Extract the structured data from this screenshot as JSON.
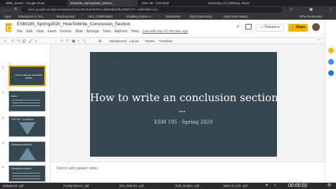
{
  "browser": {
    "tabs": [
      {
        "label": "Slide_Series - Google Drive"
      },
      {
        "label": "ESM195_Spring2020_HowTo..."
      },
      {
        "label": "ENV 38 - Fall 2019"
      },
      {
        "label": "University of California, Davis"
      }
    ],
    "url": "docs.google.com/presentation/d/1QvmRL9r4h0H8YLzd6N6BG6f5v3Z8EYbT...edit#slide=id.p",
    "bookmarks": [
      "Apps",
      "Introduction to Sm...",
      "Teaching Help",
      "GIS_COMPANIES",
      "Installing Python o...",
      "Bookmarks",
      "https://eplanning...",
      "Open Data Institut...",
      "Other Bookmarks"
    ]
  },
  "docs": {
    "title": "ESM195_Spring2020_HowToWrite_Conclusion_Section",
    "menu": [
      "File",
      "Edit",
      "View",
      "Insert",
      "Format",
      "Slide",
      "Arrange",
      "Tools",
      "Add-ons",
      "Help"
    ],
    "last_edit": "Last edit was 41 minutes ago",
    "present_label": "Present",
    "share_label": "Share",
    "toolbar": {
      "background": "Background",
      "layout": "Layout",
      "theme": "Theme",
      "transition": "Transition"
    }
  },
  "slides": [
    {
      "num": "1",
      "title": "How to write an conclusion section"
    },
    {
      "num": "2",
      "title": "Notes"
    },
    {
      "num": "3",
      "title": "ESM 195 - Conclusion"
    },
    {
      "num": "4",
      "title": "Discussion elements"
    },
    {
      "num": "5",
      "title": "Discussion structure"
    }
  ],
  "current_slide": {
    "title": "How to write an conclusion section",
    "dots": "•••",
    "subtitle": "ESM 195 - Spring 2020"
  },
  "notes_placeholder": "Click to add speaker notes",
  "downloads": [
    "Bulletproof...pdf",
    "Faculty-Recrui...pdf",
    "INS_2020-03...pdf",
    "bulk_Dropbo...pdf",
    "Bank of ol 20...pdf"
  ],
  "recorder": {
    "time": "00:00:02"
  }
}
